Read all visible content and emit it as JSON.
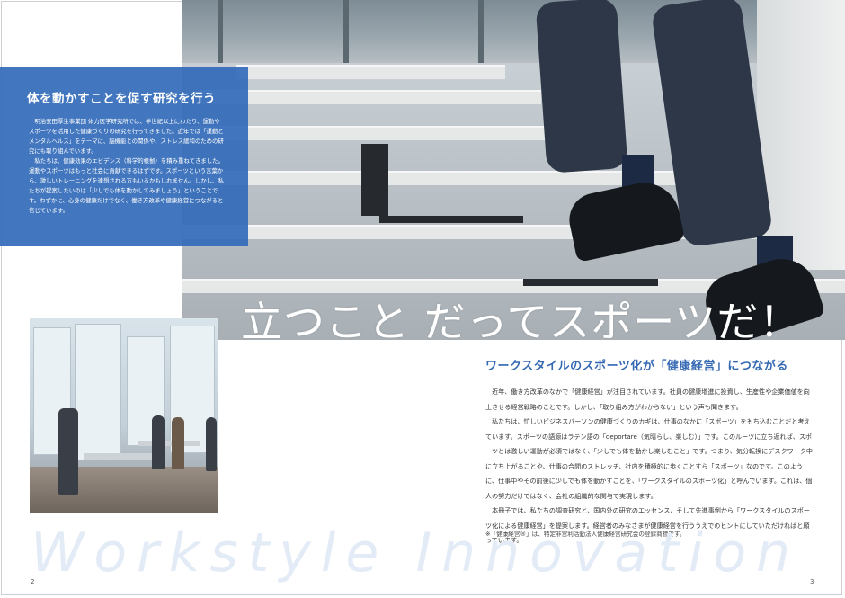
{
  "left_box": {
    "title": "体を動かすことを促す研究を行う",
    "paragraphs": [
      "明治安田厚生事業団 体力医学研究所では、半世紀以上にわたり、運動やスポーツを活用した健康づくりの研究を行ってきました。近年では「運動とメンタルヘルス」をテーマに、脳機能との関係や、ストレス緩和のための研究にも取り組んでいます。",
      "私たちは、健康効果のエビデンス（科学的根拠）を積み重ねてきました。運動やスポーツはもっと社会に貢献できるはずです。スポーツという言葉から、激しいトレーニングを連想される方もいるかもしれません。しかし、私たちが提案したいのは「少しでも体を動かしてみましょう」ということです。わずかに、心身の健康だけでなく、働き方改革や健康経営につながると信じています。"
    ]
  },
  "headline": "立つこと だってスポーツだ！",
  "section": {
    "title": "ワークスタイルのスポーツ化が「健康経営」につながる",
    "paragraphs": [
      "近年、働き方改革のなかで「健康経営」が注目されています。社員の健康増進に投資し、生産性や企業価値を向上させる経営戦略のことです。しかし、「取り組み方がわからない」という声も聞きます。",
      "私たちは、忙しいビジネスパーソンの健康づくりのカギは、仕事のなかに「スポーツ」をもち込むことだと考えています。スポーツの語源はラテン語の「deportare（気晴らし、楽しむ）」です。このルーツに立ち返れば、スポーツとは激しい運動が必須ではなく、「少しでも体を動かし楽しむこと」です。つまり、気分転換にデスクワーク中に立ち上がることや、仕事の合間のストレッチ、社内を積極的に歩くことすら「スポーツ」なのです。このように、仕事中やその前後に少しでも体を動かすことを、「ワークスタイルのスポーツ化」と呼んでいます。これは、個人の努力だけではなく、会社の組織的な関与で実現します。",
      "本冊子では、私たちの調査研究と、国内外の研究のエッセンス、そして先進事例から「ワークスタイルのスポーツ化による健康経営」を提案します。経営者のみなさまが健康経営を行ううえでのヒントにしていただければと願っています。"
    ],
    "note": "※「健康経営®」は、特定非営利活動法人健康経営研究会の登録商標です。"
  },
  "watermark": "Workstyle Innovation",
  "page_numbers": {
    "left": "2",
    "right": "3"
  },
  "colors": {
    "accent_blue": "#3569b3",
    "box_blue": "#346cb9",
    "watermark": "#e3ecf6"
  }
}
